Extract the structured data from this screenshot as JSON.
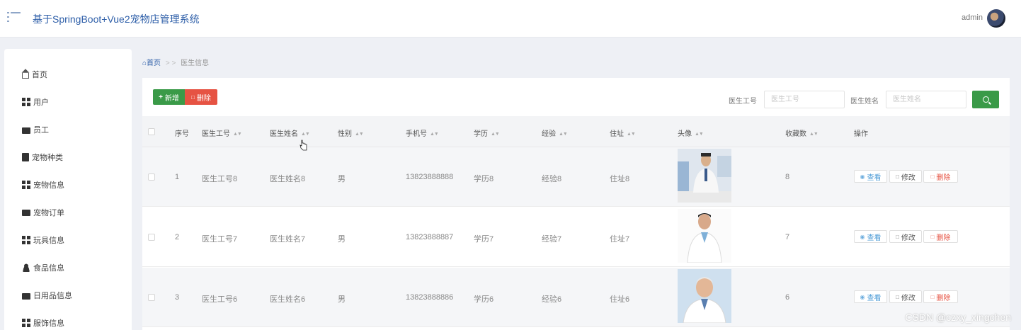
{
  "app": {
    "title": "基于SpringBoot+Vue2宠物店管理系统",
    "user": "admin"
  },
  "sidebar": {
    "items": [
      {
        "label": "首页",
        "icon": "home-icon"
      },
      {
        "label": "用户",
        "icon": "grid-icon"
      },
      {
        "label": "员工",
        "icon": "briefcase-icon"
      },
      {
        "label": "宠物种类",
        "icon": "clipboard-icon"
      },
      {
        "label": "宠物信息",
        "icon": "grid-icon"
      },
      {
        "label": "宠物订单",
        "icon": "card-icon"
      },
      {
        "label": "玩具信息",
        "icon": "grid-icon"
      },
      {
        "label": "食品信息",
        "icon": "person-icon"
      },
      {
        "label": "日用品信息",
        "icon": "suitcase-icon"
      },
      {
        "label": "服饰信息",
        "icon": "grid-icon"
      }
    ]
  },
  "breadcrumb": {
    "home": "首页",
    "separator": "> >",
    "current": "医生信息"
  },
  "toolbar": {
    "add_label": "新增",
    "delete_label": "删除"
  },
  "search": {
    "id_label": "医生工号",
    "id_placeholder": "医生工号",
    "name_label": "医生姓名",
    "name_placeholder": "医生姓名"
  },
  "table": {
    "headers": [
      "序号",
      "医生工号",
      "医生姓名",
      "性别",
      "手机号",
      "学历",
      "经验",
      "住址",
      "头像",
      "收藏数",
      "操作"
    ],
    "rows": [
      {
        "index": "1",
        "id": "医生工号8",
        "name": "医生姓名8",
        "gender": "男",
        "phone": "13823888888",
        "edu": "学历8",
        "exp": "经验8",
        "addr": "住址8",
        "fav": "8"
      },
      {
        "index": "2",
        "id": "医生工号7",
        "name": "医生姓名7",
        "gender": "男",
        "phone": "13823888887",
        "edu": "学历7",
        "exp": "经验7",
        "addr": "住址7",
        "fav": "7"
      },
      {
        "index": "3",
        "id": "医生工号6",
        "name": "医生姓名6",
        "gender": "男",
        "phone": "13823888886",
        "edu": "学历6",
        "exp": "经验6",
        "addr": "住址6",
        "fav": "6"
      }
    ],
    "actions": {
      "view": "查看",
      "edit": "修改",
      "delete": "删除"
    }
  },
  "watermark": "CSDN @czxy_xingchen",
  "colors": {
    "primary": "#2d5ea8",
    "success": "#3a9a48",
    "danger": "#e65343",
    "info": "#4a9ad6"
  }
}
